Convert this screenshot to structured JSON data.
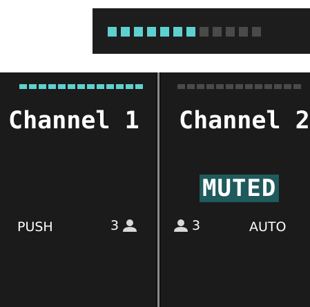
{
  "top_meter": {
    "level_segments_on": 7,
    "total_segments": 12,
    "on_color": "#5fd0d0",
    "off_color": "#4a4a4a"
  },
  "channels": [
    {
      "title": "Channel 1",
      "mode": "PUSH",
      "user_count": "3",
      "muted": false,
      "meter_segments_on": 13,
      "meter_total_segments": 13
    },
    {
      "title": "Channel 2",
      "mode": "AUTO",
      "user_count": "3",
      "muted": true,
      "muted_label": "MUTED",
      "meter_segments_on": 0,
      "meter_total_segments": 13
    }
  ],
  "icons": {
    "user": "person-icon"
  },
  "colors": {
    "panel_bg": "#1b1b1b",
    "accent": "#5fd0d0",
    "muted_bg": "#1f5a5c",
    "divider": "#8c8c8c"
  }
}
